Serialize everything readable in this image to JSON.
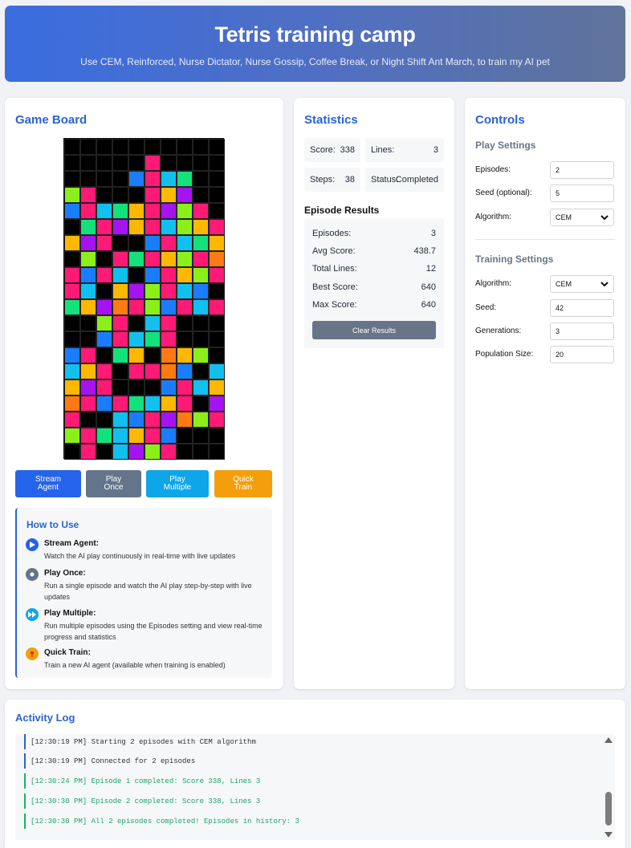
{
  "header": {
    "title": "Tetris training camp",
    "subtitle": "Use CEM, Reinforced, Nurse Dictator, Nurse Gossip, Coffee Break, or Night Shift Ant March, to train my AI pet"
  },
  "game": {
    "title": "Game Board",
    "board_rows": [
      "..........",
      "..........",
      ".....P....",
      "....BPCG..",
      "LP...PYV..",
      "BPCGYPVLP.",
      ".GPVYPCLYP",
      "YVP..BPCGY",
      ".L.PGPYLPO",
      "PBPC.BPYLP",
      "PC.YVLPCB.",
      "GYVOPLBPCP",
      "..LP.CP...",
      "..BPCGP...",
      "BP.GY.OYL.",
      "CYP.PPOB.C",
      "YVP...BPCY",
      "OPBPGCYP.V",
      "P..CBPVOLP",
      "LPGCYPB...",
      ".P.CVLP..."
    ],
    "palette": {
      ".": "#000000",
      "P": "#ff1a75",
      "B": "#1a7dff",
      "C": "#12c0f0",
      "G": "#13e27c",
      "L": "#8bf01a",
      "Y": "#ffb800",
      "V": "#a513f0",
      "O": "#ff7a12"
    },
    "buttons": {
      "stream": [
        "Stream",
        "Agent"
      ],
      "play_once": [
        "Play",
        "Once"
      ],
      "play_multiple": [
        "Play",
        "Multiple"
      ],
      "quick_train": [
        "Quick",
        "Train"
      ]
    },
    "howto": {
      "title": "How to Use",
      "items": [
        {
          "title": "Stream Agent:",
          "desc": "Watch the AI play continuously in real-time with live updates"
        },
        {
          "title": "Play Once:",
          "desc": "Run a single episode and watch the AI play step-by-step with live updates"
        },
        {
          "title": "Play Multiple:",
          "desc": "Run multiple episodes using the Episodes setting and view real-time progress and statistics"
        },
        {
          "title": "Quick Train:",
          "desc": "Train a new AI agent (available when training is enabled)"
        }
      ]
    }
  },
  "stats": {
    "title": "Statistics",
    "score_label": "Score:",
    "score": "338",
    "lines_label": "Lines:",
    "lines": "3",
    "steps_label": "Steps:",
    "steps": "38",
    "status_label": "Status:",
    "status": "Completed",
    "episode_results_title": "Episode Results",
    "results": [
      {
        "label": "Episodes:",
        "value": "3"
      },
      {
        "label": "Avg Score:",
        "value": "438.7"
      },
      {
        "label": "Total Lines:",
        "value": "12"
      },
      {
        "label": "Best Score:",
        "value": "640"
      },
      {
        "label": "Max Score:",
        "value": "640"
      }
    ],
    "clear_label": "Clear Results"
  },
  "controls": {
    "title": "Controls",
    "play_settings_title": "Play Settings",
    "episodes_label": "Episodes:",
    "episodes_value": "2",
    "seed_label": "Seed (optional):",
    "seed_value": "5",
    "algorithm_label": "Algorithm:",
    "algorithm_value": "CEM",
    "training_settings_title": "Training Settings",
    "train_algorithm_label": "Algorithm:",
    "train_algorithm_value": "CEM",
    "train_seed_label": "Seed:",
    "train_seed_value": "42",
    "generations_label": "Generations:",
    "generations_value": "3",
    "population_label": "Population Size:",
    "population_value": "20"
  },
  "log": {
    "title": "Activity Log",
    "lines": [
      {
        "text": "[12:30:19 PM] Starting 2 episodes with CEM algorithm",
        "kind": "info"
      },
      {
        "text": "[12:30:19 PM] Connected for 2 episodes",
        "kind": "info"
      },
      {
        "text": "[12:30:24 PM] Episode 1 completed: Score 338, Lines 3",
        "kind": "success"
      },
      {
        "text": "[12:30:30 PM] Episode 2 completed: Score 338, Lines 3",
        "kind": "success"
      },
      {
        "text": "[12:30:30 PM] All 2 episodes completed! Episodes in history: 3",
        "kind": "success"
      }
    ]
  },
  "colors": {
    "accent": "#2a63d4",
    "stream": "#2563eb",
    "play_once": "#64748b",
    "play_multiple": "#0ea5e9",
    "quick_train": "#f59e0b"
  }
}
